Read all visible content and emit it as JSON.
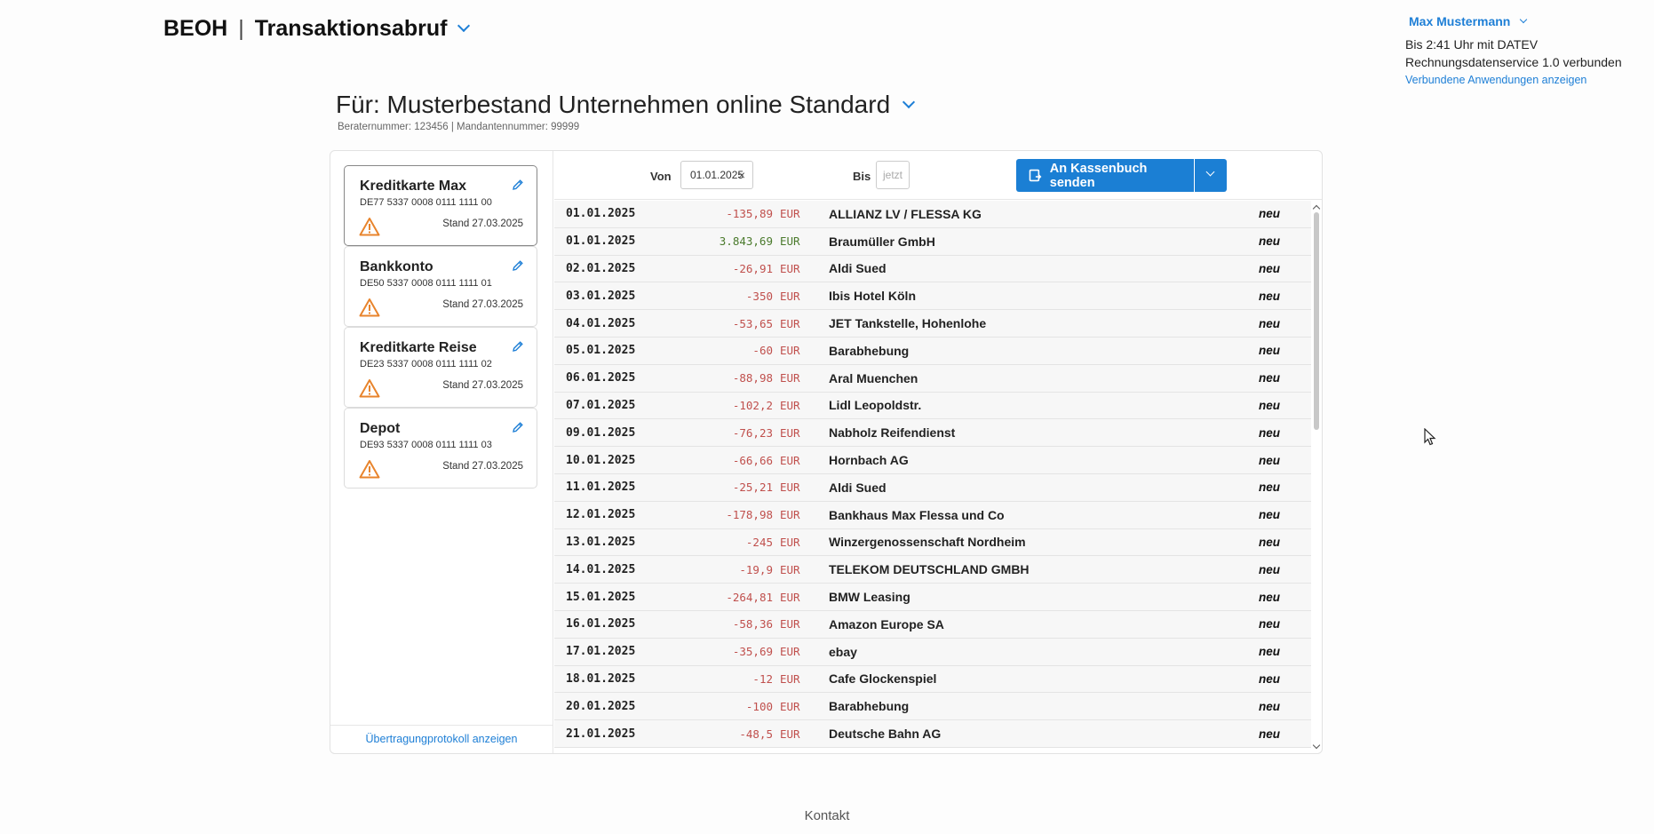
{
  "header": {
    "brand": "BEOH",
    "app_title": "Transaktionsabruf"
  },
  "user": {
    "name": "Max Mustermann",
    "connection": "Bis 2:41 Uhr mit DATEV Rechnungsdatenservice 1.0 verbunden",
    "link": "Verbundene Anwendungen anzeigen"
  },
  "client": {
    "title": "Für: Musterbestand Unternehmen online Standard",
    "subinfo": "Beraternummer: 123456 | Mandantennummer: 99999"
  },
  "accounts": [
    {
      "title": "Kreditkarte Max",
      "iban": "DE77 5337 0008 0111 1111 00",
      "stand": "Stand 27.03.2025"
    },
    {
      "title": "Bankkonto",
      "iban": "DE50 5337 0008 0111 1111 01",
      "stand": "Stand 27.03.2025"
    },
    {
      "title": "Kreditkarte Reise",
      "iban": "DE23 5337 0008 0111 1111 02",
      "stand": "Stand 27.03.2025"
    },
    {
      "title": "Depot",
      "iban": "DE93 5337 0008 0111 1111 03",
      "stand": "Stand 27.03.2025"
    }
  ],
  "protocol_link": "Übertragungprotokoll anzeigen",
  "filter": {
    "von_label": "Von",
    "von_value": "01.01.2025",
    "clear": "×",
    "bis_label": "Bis",
    "bis_placeholder": "jetzt"
  },
  "send_button": "An Kassenbuch senden",
  "transactions": [
    {
      "date": "01.01.2025",
      "amount": "-135,89",
      "currency": "EUR",
      "payee": "ALLIANZ LV / FLESSA KG",
      "status": "neu"
    },
    {
      "date": "01.01.2025",
      "amount": "3.843,69",
      "currency": "EUR",
      "payee": "Braumüller GmbH",
      "status": "neu"
    },
    {
      "date": "02.01.2025",
      "amount": "-26,91",
      "currency": "EUR",
      "payee": "Aldi Sued",
      "status": "neu"
    },
    {
      "date": "03.01.2025",
      "amount": "-350",
      "currency": "EUR",
      "payee": "Ibis Hotel Köln",
      "status": "neu"
    },
    {
      "date": "04.01.2025",
      "amount": "-53,65",
      "currency": "EUR",
      "payee": "JET Tankstelle, Hohenlohe",
      "status": "neu"
    },
    {
      "date": "05.01.2025",
      "amount": "-60",
      "currency": "EUR",
      "payee": "Barabhebung",
      "status": "neu"
    },
    {
      "date": "06.01.2025",
      "amount": "-88,98",
      "currency": "EUR",
      "payee": "Aral Muenchen",
      "status": "neu"
    },
    {
      "date": "07.01.2025",
      "amount": "-102,2",
      "currency": "EUR",
      "payee": "Lidl Leopoldstr.",
      "status": "neu"
    },
    {
      "date": "09.01.2025",
      "amount": "-76,23",
      "currency": "EUR",
      "payee": "Nabholz Reifendienst",
      "status": "neu"
    },
    {
      "date": "10.01.2025",
      "amount": "-66,66",
      "currency": "EUR",
      "payee": "Hornbach AG",
      "status": "neu"
    },
    {
      "date": "11.01.2025",
      "amount": "-25,21",
      "currency": "EUR",
      "payee": "Aldi Sued",
      "status": "neu"
    },
    {
      "date": "12.01.2025",
      "amount": "-178,98",
      "currency": "EUR",
      "payee": "Bankhaus Max Flessa und Co",
      "status": "neu"
    },
    {
      "date": "13.01.2025",
      "amount": "-245",
      "currency": "EUR",
      "payee": "Winzergenossenschaft Nordheim",
      "status": "neu"
    },
    {
      "date": "14.01.2025",
      "amount": "-19,9",
      "currency": "EUR",
      "payee": "TELEKOM DEUTSCHLAND GMBH",
      "status": "neu"
    },
    {
      "date": "15.01.2025",
      "amount": "-264,81",
      "currency": "EUR",
      "payee": "BMW Leasing",
      "status": "neu"
    },
    {
      "date": "16.01.2025",
      "amount": "-58,36",
      "currency": "EUR",
      "payee": "Amazon Europe SA",
      "status": "neu"
    },
    {
      "date": "17.01.2025",
      "amount": "-35,69",
      "currency": "EUR",
      "payee": "ebay",
      "status": "neu"
    },
    {
      "date": "18.01.2025",
      "amount": "-12",
      "currency": "EUR",
      "payee": "Cafe Glockenspiel",
      "status": "neu"
    },
    {
      "date": "20.01.2025",
      "amount": "-100",
      "currency": "EUR",
      "payee": "Barabhebung",
      "status": "neu"
    },
    {
      "date": "21.01.2025",
      "amount": "-48,5",
      "currency": "EUR",
      "payee": "Deutsche Bahn AG",
      "status": "neu"
    }
  ],
  "footer": {
    "contact": "Kontakt"
  },
  "colors": {
    "accent": "#1b7fd4",
    "negative": "#c0504d",
    "positive": "#4a7a2c",
    "warning": "#e8842c"
  },
  "icons": {
    "edit": "pencil-icon",
    "warning": "warning-triangle-icon",
    "send": "send-to-cashbook-icon"
  }
}
